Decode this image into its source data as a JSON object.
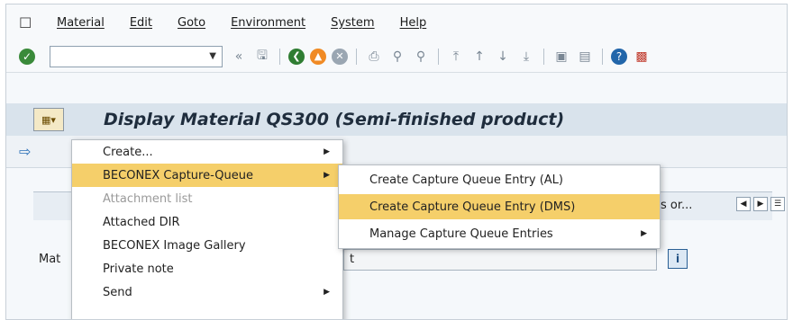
{
  "menubar": {
    "items": [
      "Material",
      "Edit",
      "Goto",
      "Environment",
      "System",
      "Help"
    ]
  },
  "toolbar": {
    "command_field_value": "",
    "icons": [
      "enter-icon",
      "save-icon",
      "back-icon",
      "exit-icon",
      "cancel-icon",
      "print-icon",
      "find-icon",
      "find-next-icon",
      "first-page-icon",
      "previous-page-icon",
      "next-page-icon",
      "last-page-icon",
      "create-session-icon",
      "shortcut-icon",
      "help-icon",
      "layout-menu-icon"
    ]
  },
  "title": {
    "text": "Display Material QS300 (Semi-finished product)"
  },
  "tabstrip": {
    "partial_label": "s or..."
  },
  "field": {
    "label": "Mat",
    "value_tail": "t"
  },
  "context_menu": {
    "items": [
      {
        "label": "Create...",
        "has_submenu": true,
        "highlighted": false,
        "disabled": false
      },
      {
        "label": "BECONEX Capture-Queue",
        "has_submenu": true,
        "highlighted": true,
        "disabled": false
      },
      {
        "label": "Attachment list",
        "has_submenu": false,
        "highlighted": false,
        "disabled": true
      },
      {
        "label": "Attached DIR",
        "has_submenu": false,
        "highlighted": false,
        "disabled": false
      },
      {
        "label": "BECONEX Image Gallery",
        "has_submenu": false,
        "highlighted": false,
        "disabled": false
      },
      {
        "label": "Private note",
        "has_submenu": false,
        "highlighted": false,
        "disabled": false
      },
      {
        "label": "Send",
        "has_submenu": true,
        "highlighted": false,
        "disabled": false
      }
    ]
  },
  "submenu": {
    "items": [
      {
        "label": "Create Capture Queue Entry (AL)",
        "has_submenu": false,
        "highlighted": false
      },
      {
        "label": "Create Capture Queue Entry (DMS)",
        "has_submenu": false,
        "highlighted": true
      },
      {
        "label": "Manage Capture Queue Entries",
        "has_submenu": true,
        "highlighted": false
      }
    ]
  },
  "colors": {
    "highlight": "#f5cf6a",
    "title_bar": "#d9e3ec"
  }
}
